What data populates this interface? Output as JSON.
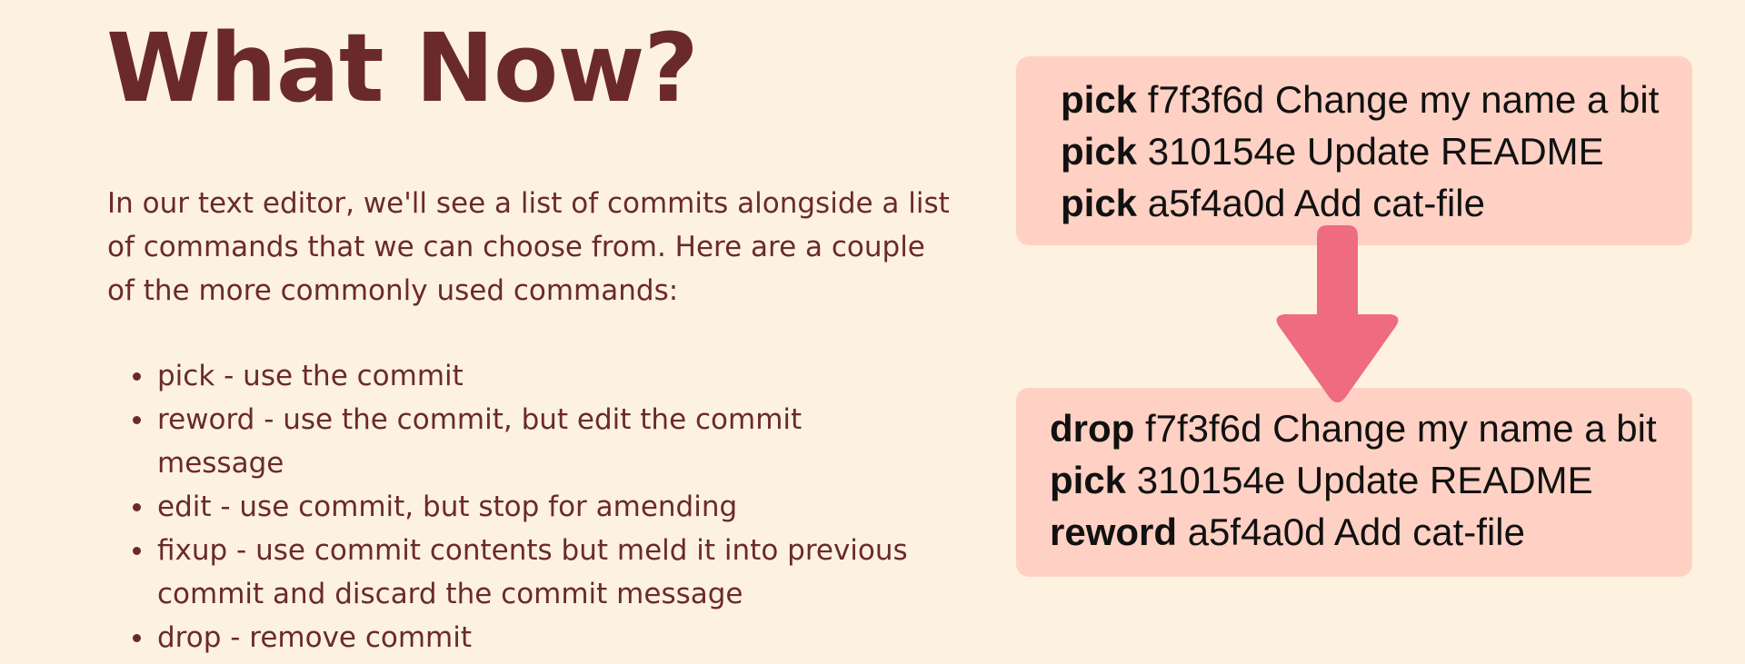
{
  "title": "What Now?",
  "intro": "In our text editor, we'll see a list of commits alongside a list of commands that we can choose from. Here are a couple of the more commonly used commands:",
  "commands": [
    {
      "text": "pick - use the commit"
    },
    {
      "text": "reword - use the commit, but edit the commit message"
    },
    {
      "text": "edit - use commit, but stop for amending"
    },
    {
      "text": "fixup - use commit contents but meld it into previous commit and discard the commit message"
    },
    {
      "text": "drop - remove commit"
    }
  ],
  "before": [
    {
      "command": "pick",
      "rest": " f7f3f6d Change my name a bit"
    },
    {
      "command": "pick",
      "rest": " 310154e Update README"
    },
    {
      "command": "pick",
      "rest": " a5f4a0d Add cat-file"
    }
  ],
  "after": [
    {
      "command": "drop",
      "rest": " f7f3f6d Change my name a bit"
    },
    {
      "command": "pick",
      "rest": " 310154e Update README"
    },
    {
      "command": "reword",
      "rest": " a5f4a0d Add cat-file"
    }
  ],
  "colors": {
    "background": "#fdf2e0",
    "text": "#6b2a2a",
    "box": "#ffd1c4",
    "arrow": "#ef6b80"
  },
  "icons": {
    "arrow": "down-arrow-icon"
  }
}
